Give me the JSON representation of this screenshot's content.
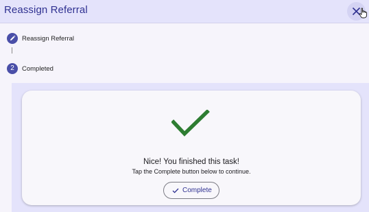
{
  "header": {
    "title": "Reassign Referral",
    "close_icon": "close-icon"
  },
  "steps": [
    {
      "marker": "edit-icon",
      "label": "Reassign Referral"
    },
    {
      "marker": "2",
      "label": "Completed"
    }
  ],
  "card": {
    "icon": "checkmark-icon",
    "title": "Nice! You finished this task!",
    "subtitle": "Tap the Complete button below to continue.",
    "button_label": "Complete"
  },
  "colors": {
    "header_bg": "#e4e3fb",
    "accent": "#2f3191",
    "step_circle": "#4a4fa8",
    "success_green": "#2e7d32"
  }
}
